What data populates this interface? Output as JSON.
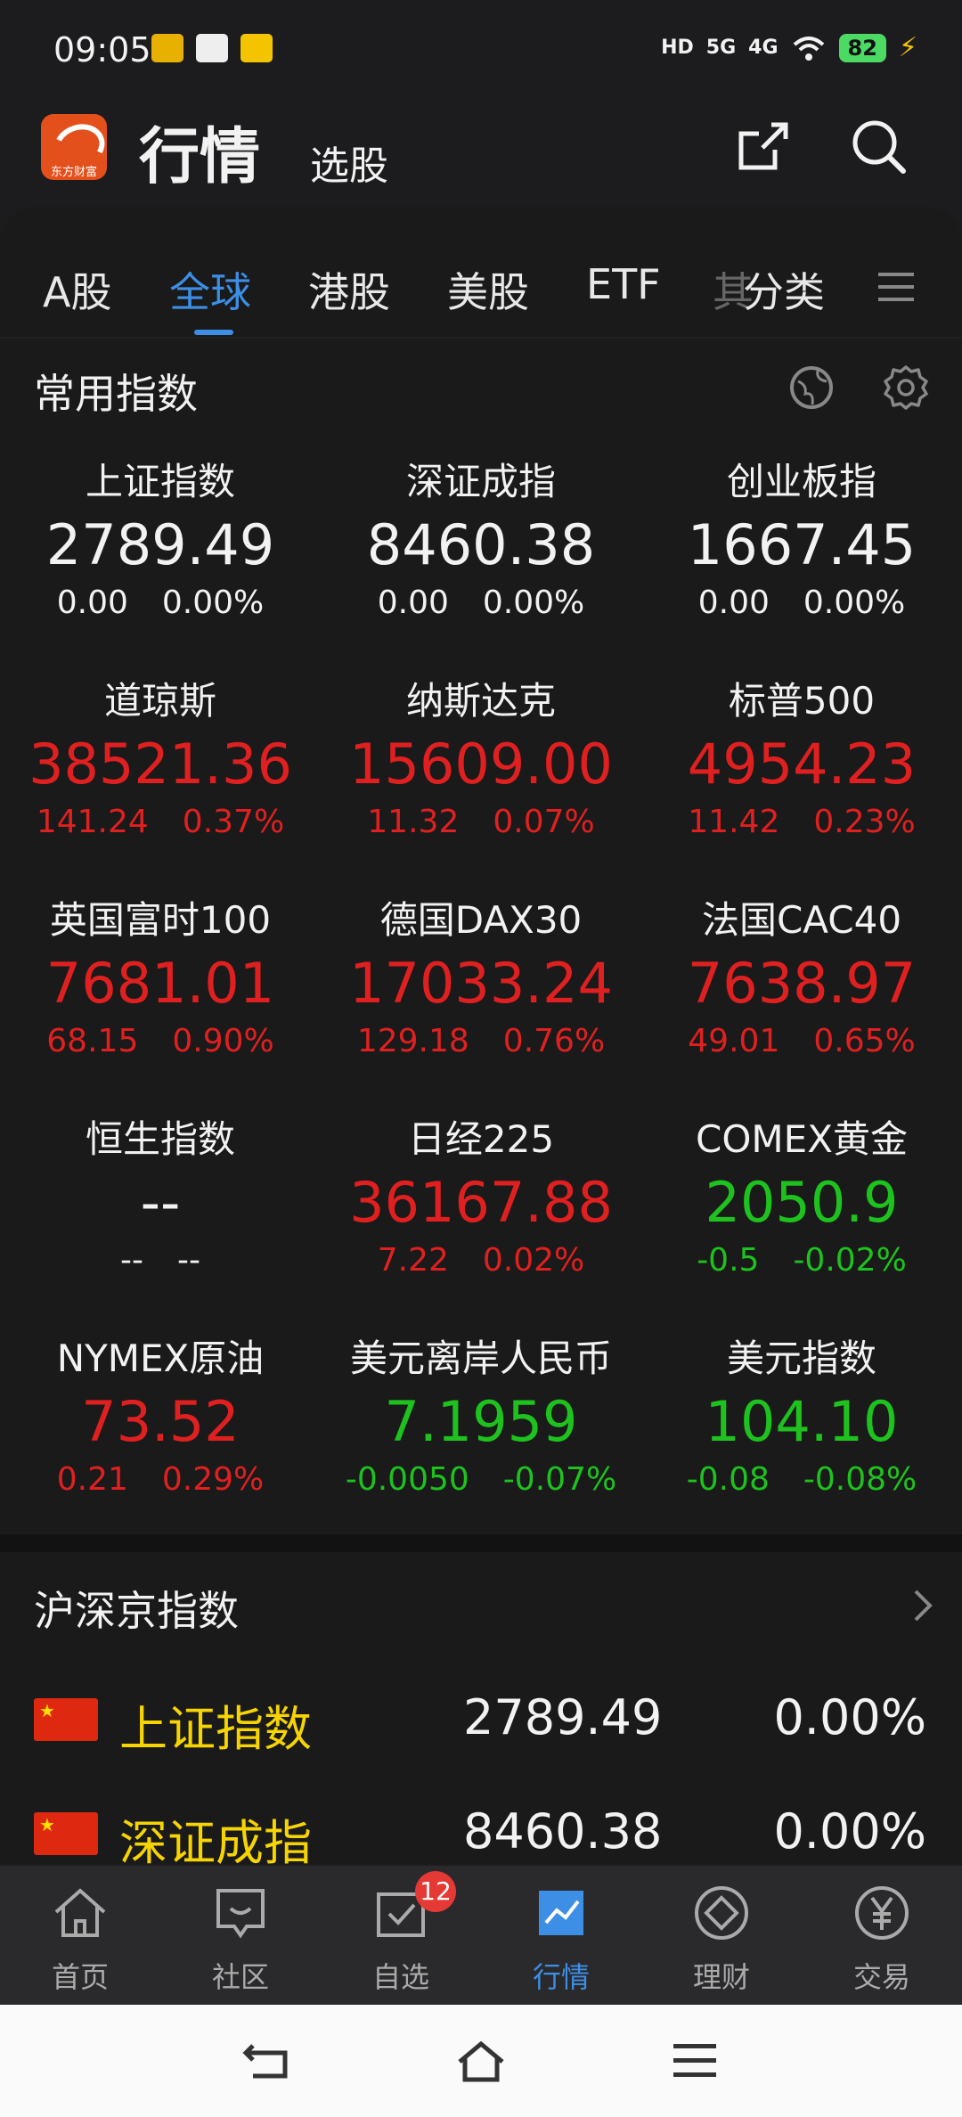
{
  "status": {
    "time": "09:05",
    "network_hd": "HD",
    "net1": "5G",
    "net2": "4G",
    "battery": "82"
  },
  "header": {
    "logo_text": "东方财富",
    "title": "行情",
    "subtitle": "选股"
  },
  "tabs": [
    {
      "label": "A股"
    },
    {
      "label": "全球"
    },
    {
      "label": "港股"
    },
    {
      "label": "美股"
    },
    {
      "label": "ETF"
    },
    {
      "label": "分类"
    }
  ],
  "tab_partial": "其",
  "common_indices": {
    "title": "常用指数",
    "items": [
      {
        "name": "上证指数",
        "price": "2789.49",
        "change": "0.00",
        "pct": "0.00%",
        "trend": "flat"
      },
      {
        "name": "深证成指",
        "price": "8460.38",
        "change": "0.00",
        "pct": "0.00%",
        "trend": "flat"
      },
      {
        "name": "创业板指",
        "price": "1667.45",
        "change": "0.00",
        "pct": "0.00%",
        "trend": "flat"
      },
      {
        "name": "道琼斯",
        "price": "38521.36",
        "change": "141.24",
        "pct": "0.37%",
        "trend": "up"
      },
      {
        "name": "纳斯达克",
        "price": "15609.00",
        "change": "11.32",
        "pct": "0.07%",
        "trend": "up"
      },
      {
        "name": "标普500",
        "price": "4954.23",
        "change": "11.42",
        "pct": "0.23%",
        "trend": "up"
      },
      {
        "name": "英国富时100",
        "price": "7681.01",
        "change": "68.15",
        "pct": "0.90%",
        "trend": "up"
      },
      {
        "name": "德国DAX30",
        "price": "17033.24",
        "change": "129.18",
        "pct": "0.76%",
        "trend": "up"
      },
      {
        "name": "法国CAC40",
        "price": "7638.97",
        "change": "49.01",
        "pct": "0.65%",
        "trend": "up"
      },
      {
        "name": "恒生指数",
        "price": "--",
        "change": "--",
        "pct": "--",
        "trend": "flat"
      },
      {
        "name": "日经225",
        "price": "36167.88",
        "change": "7.22",
        "pct": "0.02%",
        "trend": "up"
      },
      {
        "name": "COMEX黄金",
        "price": "2050.9",
        "change": "-0.5",
        "pct": "-0.02%",
        "trend": "down"
      },
      {
        "name": "NYMEX原油",
        "price": "73.52",
        "change": "0.21",
        "pct": "0.29%",
        "trend": "up"
      },
      {
        "name": "美元离岸人民币",
        "price": "7.1959",
        "change": "-0.0050",
        "pct": "-0.07%",
        "trend": "down"
      },
      {
        "name": "美元指数",
        "price": "104.10",
        "change": "-0.08",
        "pct": "-0.08%",
        "trend": "down"
      }
    ]
  },
  "hsj": {
    "title": "沪深京指数",
    "rows": [
      {
        "name": "上证指数",
        "price": "2789.49",
        "pct": "0.00%"
      },
      {
        "name": "深证成指",
        "price": "8460.38",
        "pct": "0.00%"
      }
    ]
  },
  "bottom_nav": [
    {
      "label": "首页",
      "icon": "home-icon"
    },
    {
      "label": "社区",
      "icon": "community-icon"
    },
    {
      "label": "自选",
      "icon": "watchlist-icon",
      "badge": "12"
    },
    {
      "label": "行情",
      "icon": "market-icon",
      "active": true
    },
    {
      "label": "理财",
      "icon": "wealth-icon"
    },
    {
      "label": "交易",
      "icon": "trade-icon"
    }
  ],
  "colors": {
    "accent": "#3d8ee5",
    "up": "#e02020",
    "down": "#1ec21e",
    "highlight": "#f5d400"
  }
}
